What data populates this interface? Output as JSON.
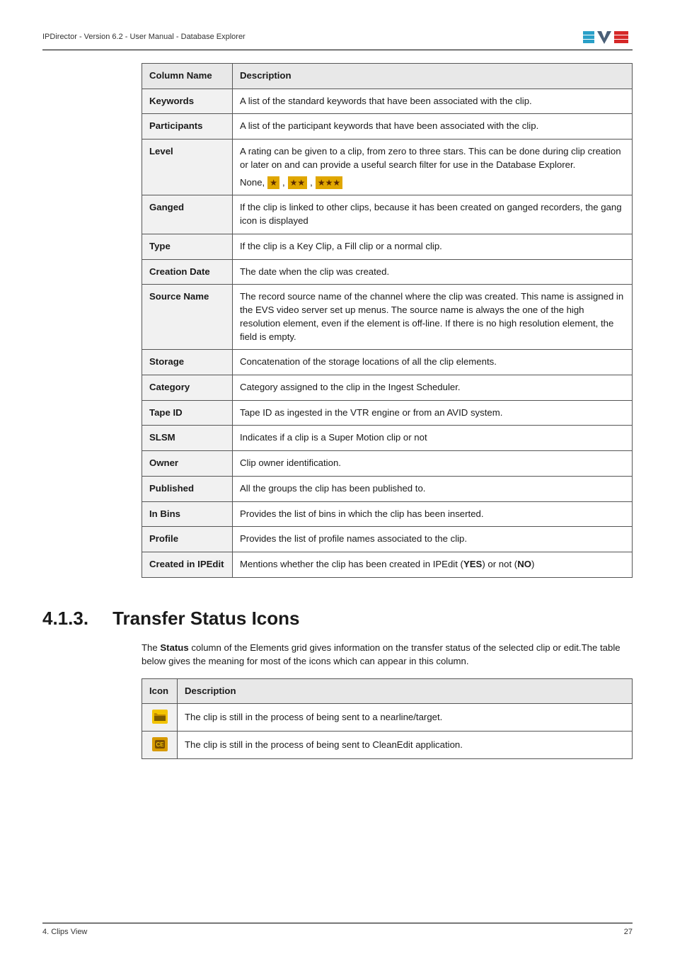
{
  "header": {
    "left": "IPDirector - Version 6.2 - User Manual - Database Explorer"
  },
  "table1": {
    "head": {
      "col1": "Column Name",
      "col2": "Description"
    },
    "rows": [
      {
        "name": "Keywords",
        "desc": "A list of the standard keywords that have been associated with the clip."
      },
      {
        "name": "Participants",
        "desc": "A list of the participant keywords that have been associated with the clip."
      },
      {
        "name": "Level",
        "desc": "A rating can be given to a clip, from zero to three stars. This can be done during clip creation or later on and can provide a useful search filter for use in the Database Explorer.",
        "none_prefix": "None,"
      },
      {
        "name": "Ganged",
        "desc": "If the clip is linked to other clips, because it has been created on ganged recorders, the gang icon is displayed"
      },
      {
        "name": "Type",
        "desc": "If the clip is a Key Clip, a Fill clip or a normal clip."
      },
      {
        "name": "Creation Date",
        "desc": "The date when the clip was created."
      },
      {
        "name": "Source Name",
        "desc": "The record source name of the channel where the clip was created. This name is assigned in the EVS video server set up menus. The source name is always the one of the high resolution element, even if the element is off-line. If there is no high resolution element, the field is empty."
      },
      {
        "name": "Storage",
        "desc": "Concatenation of the storage locations of all the clip elements."
      },
      {
        "name": "Category",
        "desc": "Category assigned to the clip in the Ingest Scheduler."
      },
      {
        "name": "Tape ID",
        "desc": "Tape ID as ingested in the VTR engine or from an AVID system."
      },
      {
        "name": "SLSM",
        "desc": "Indicates if a clip is a Super Motion clip or not"
      },
      {
        "name": "Owner",
        "desc": "Clip owner identification."
      },
      {
        "name": "Published",
        "desc": "All the groups the clip has been published to."
      },
      {
        "name": "In Bins",
        "desc": "Provides the list of bins in which the clip has been inserted."
      },
      {
        "name": "Profile",
        "desc": "Provides the list of profile names associated to the clip."
      },
      {
        "name": "Created in IPEdit",
        "desc_pre": "Mentions whether the clip has been created in IPEdit (",
        "desc_yes": "YES",
        "desc_mid": ") or not (",
        "desc_no": "NO",
        "desc_post": ")"
      }
    ]
  },
  "section": {
    "number": "4.1.3.",
    "title": "Transfer Status Icons",
    "para_pre": "The ",
    "para_bold": "Status",
    "para_post": " column of the Elements grid gives information on the transfer status of the selected clip or edit.The table below gives the meaning for most of the icons which can appear in this column."
  },
  "table2": {
    "head": {
      "col1": "Icon",
      "col2": "Description"
    },
    "rows": [
      {
        "desc": "The clip is still in the process of being sent to a nearline/target."
      },
      {
        "desc": "The clip is still in the process of being sent to CleanEdit application."
      }
    ]
  },
  "footer": {
    "left": "4. Clips View",
    "right": "27"
  }
}
